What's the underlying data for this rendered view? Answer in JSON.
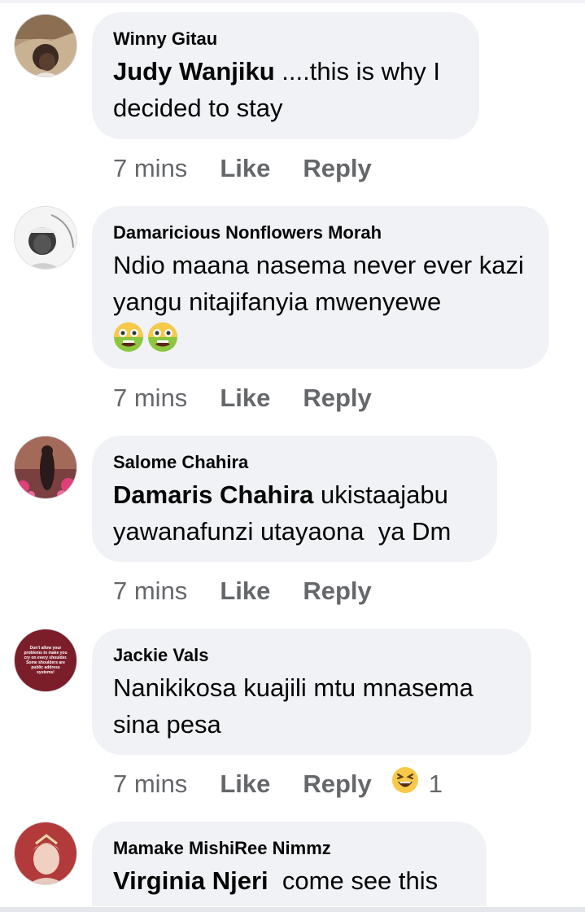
{
  "comments": [
    {
      "author": "Winny Gitau",
      "mention": "Judy Wanjiku",
      "text": " ....this is why I decided to stay",
      "time": "7 mins",
      "like": "Like",
      "reply": "Reply"
    },
    {
      "author": "Damaricious Nonflowers Morah",
      "mention": "",
      "text": "Ndio maana nasema never ever kazi yangu nitajifanyia mwenyewe",
      "emoji_icon": "nauseated-face-icon",
      "time": "7 mins",
      "like": "Like",
      "reply": "Reply"
    },
    {
      "author": "Salome Chahira",
      "mention": "Damaris Chahira",
      "text": " ukistaajabu yawanafunzi utayaona  ya Dm",
      "time": "7 mins",
      "like": "Like",
      "reply": "Reply"
    },
    {
      "author": "Jackie Vals",
      "mention": "",
      "text": "Nanikikosa kuajili mtu mnasema sina pesa",
      "avatar_text": "Don't allow your problems to make you cry on every shoulder. Some shoulders are public address systems!",
      "time": "7 mins",
      "like": "Like",
      "reply": "Reply",
      "reaction_icon": "laughing-face-icon",
      "reaction_count": "1"
    },
    {
      "author": "Mamake MishiRee Nimmz",
      "mention": "Virginia Njeri",
      "text": "  come see this"
    }
  ]
}
